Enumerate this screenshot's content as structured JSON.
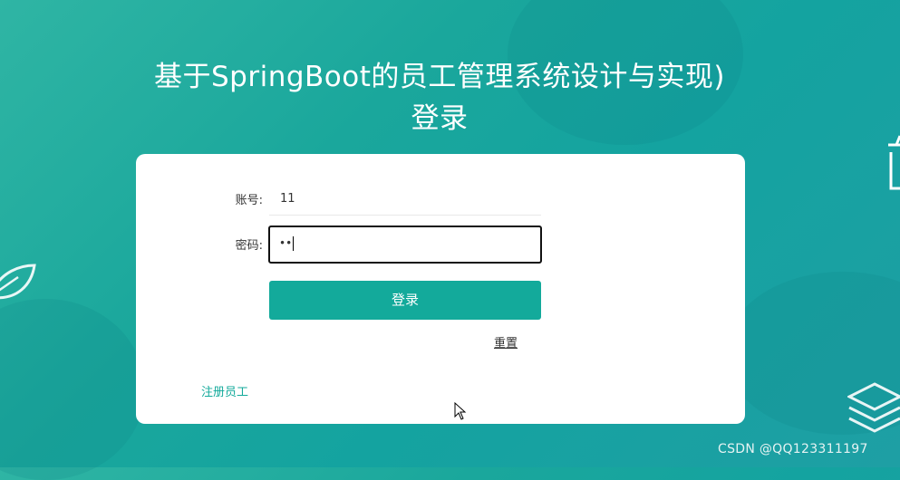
{
  "page": {
    "title": "基于SpringBoot的员工管理系统设计与实现)登录"
  },
  "form": {
    "account_label": "账号:",
    "account_value": "11",
    "password_label": "密码:",
    "password_value": "••",
    "login_label": "登录",
    "reset_label": "重置",
    "register_label": "注册员工"
  },
  "watermark": "CSDN @QQ123311197",
  "colors": {
    "accent": "#13aa9b",
    "background": "#1aa79c"
  },
  "icons": {
    "left": "leaf-icon",
    "right_top": "cup-icon",
    "right_bottom": "layers-icon",
    "cursor": "mouse-pointer-icon"
  }
}
